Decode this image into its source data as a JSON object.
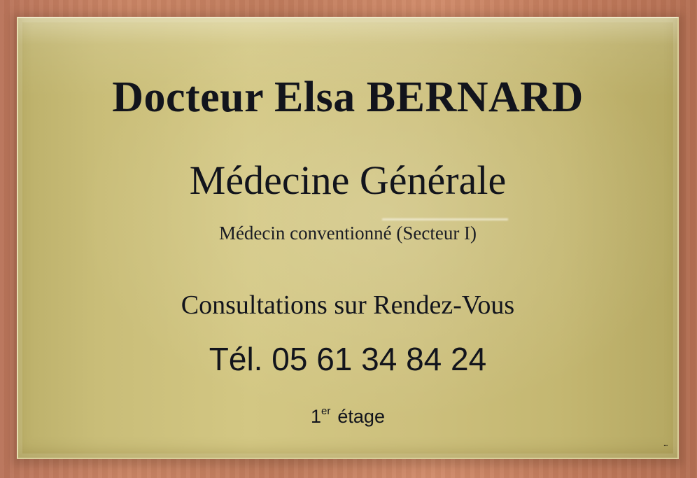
{
  "plaque": {
    "name": "Docteur Elsa BERNARD",
    "specialty": "Médecine Générale",
    "convention": "Médecin conventionné (Secteur I)",
    "consultations": "Consultations sur Rendez-Vous",
    "phone": "Tél. 05 61 34 84 24",
    "floor_number": "1",
    "floor_suffix": "er",
    "floor_word": "étage"
  },
  "colors": {
    "plaque_gold": "#cdc07d",
    "text": "#12141c",
    "wall": "#c98464"
  }
}
